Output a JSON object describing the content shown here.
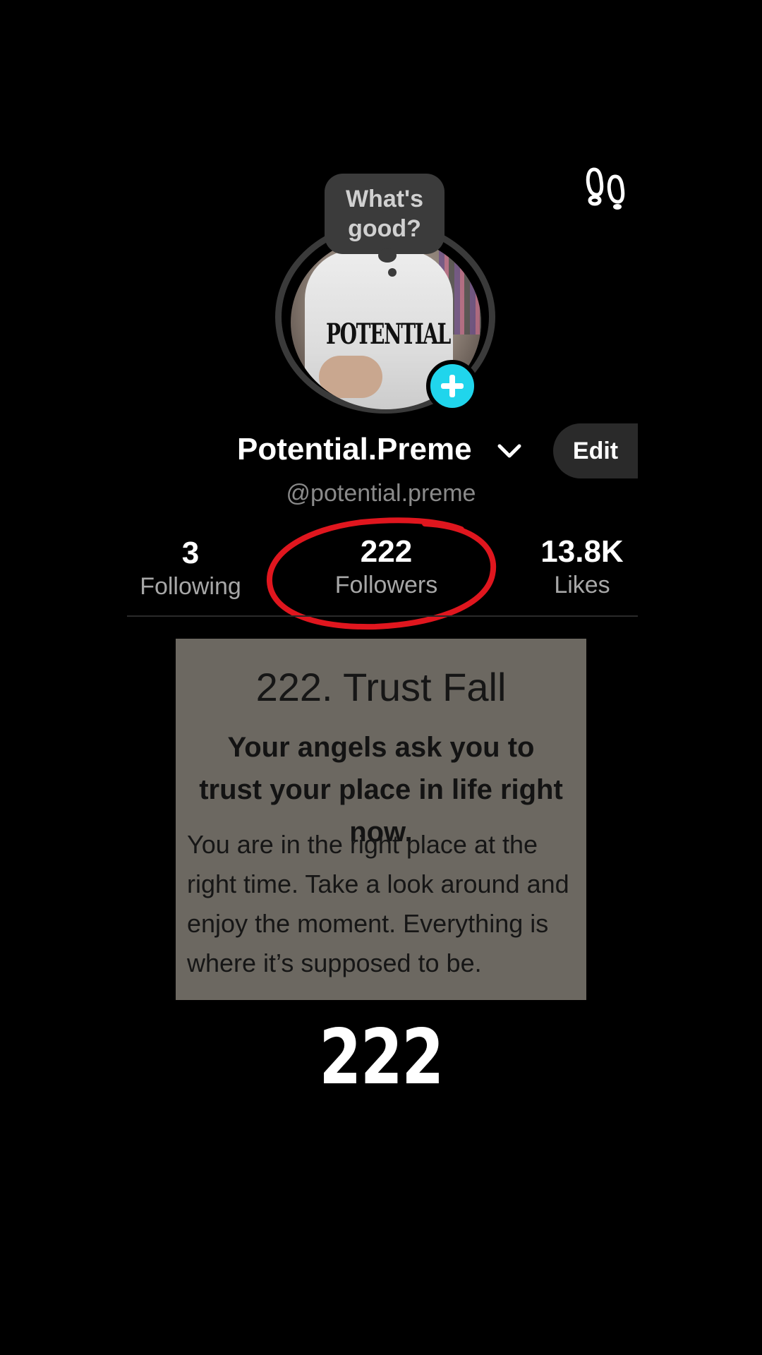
{
  "bubble": {
    "text": "What's good?"
  },
  "profile": {
    "name": "Potential.Preme",
    "handle": "@potential.preme",
    "edit_label": "Edit",
    "avatar_shirt_text": "POTENTIAL"
  },
  "stats": {
    "following": {
      "value": "3",
      "label": "Following"
    },
    "followers": {
      "value": "222",
      "label": "Followers"
    },
    "likes": {
      "value": "13.8K",
      "label": "Likes"
    }
  },
  "card": {
    "title": "222. Trust Fall",
    "subtitle": "Your angels ask you to trust your place in life right now.",
    "body": "You are in the right place at the right time. Take a look around and enjoy the moment. Everything is where it’s supposed to be."
  },
  "overlay": {
    "big_number": "222"
  },
  "icons": {
    "footprints": "footprints-icon",
    "plus": "plus-icon",
    "chevron": "chevron-down-icon"
  },
  "colors": {
    "accent": "#20d5ec",
    "annotation": "#e0161e",
    "background": "#000000"
  }
}
